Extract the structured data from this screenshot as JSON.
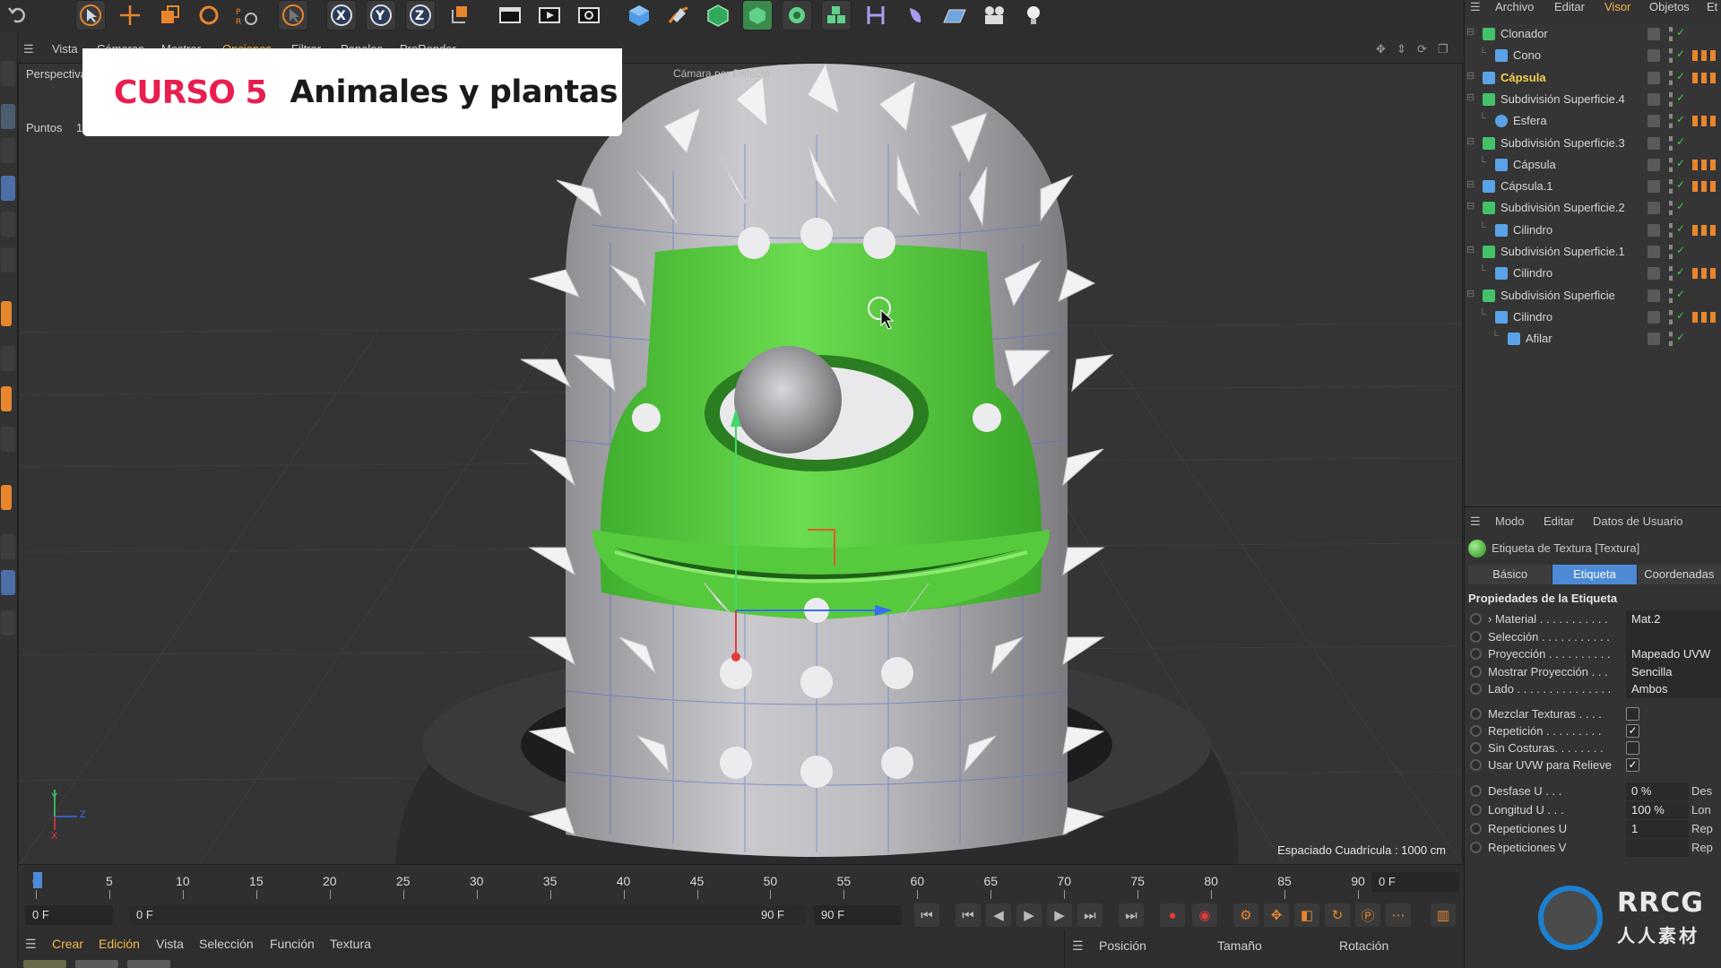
{
  "banner": {
    "tag": "CURSO 5",
    "title": "Animales y plantas"
  },
  "viewport": {
    "menu": [
      "Vista",
      "Cámaras",
      "Mostrar",
      "Opciones",
      "Filtrar",
      "Paneles",
      "ProRender"
    ],
    "active_menu": "Opciones",
    "camera_name": "Perspectiva",
    "camera_label": "Cámara por Defecto",
    "points_label": "Puntos",
    "points_value": "1",
    "grid_spacing": "Espaciado Cuadrícula : 1000 cm",
    "axis_y": "Y",
    "axis_z": "Z",
    "axis_x": "X"
  },
  "timeline": {
    "ticks": [
      "0",
      "5",
      "10",
      "15",
      "20",
      "25",
      "30",
      "35",
      "40",
      "45",
      "50",
      "55",
      "60",
      "65",
      "70",
      "75",
      "80",
      "85",
      "90"
    ],
    "current_frame": "0 F"
  },
  "transport": {
    "start": "0 F",
    "range_start": "0 F",
    "range_end": "90 F",
    "end": "90 F"
  },
  "bottom_bar": {
    "items": [
      "Crear",
      "Edición",
      "Vista",
      "Selección",
      "Función",
      "Textura"
    ],
    "coords": [
      "Posición",
      "Tamaño",
      "Rotación"
    ]
  },
  "object_manager": {
    "menu": [
      "Archivo",
      "Editar",
      "Visor",
      "Objetos",
      "Et"
    ],
    "active_menu": "Visor",
    "items": [
      {
        "label": "Clonador",
        "icon": "cloner-icon",
        "depth": 0,
        "color": "#44c26a"
      },
      {
        "label": "Cono",
        "icon": "cone-icon",
        "depth": 1,
        "color": "#5aa3e8"
      },
      {
        "label": "Cápsula",
        "icon": "capsule-icon",
        "depth": 0,
        "color": "#5aa3e8",
        "selected": true
      },
      {
        "label": "Subdivisión Superficie.4",
        "icon": "subdivision-icon",
        "depth": 0,
        "color": "#44c26a"
      },
      {
        "label": "Esfera",
        "icon": "sphere-icon",
        "depth": 1,
        "color": "#5aa3e8"
      },
      {
        "label": "Subdivisión Superficie.3",
        "icon": "subdivision-icon",
        "depth": 0,
        "color": "#44c26a"
      },
      {
        "label": "Cápsula",
        "icon": "capsule-icon",
        "depth": 1,
        "color": "#5aa3e8"
      },
      {
        "label": "Cápsula.1",
        "icon": "capsule-icon",
        "depth": 0,
        "color": "#5aa3e8"
      },
      {
        "label": "Subdivisión Superficie.2",
        "icon": "subdivision-icon",
        "depth": 0,
        "color": "#44c26a"
      },
      {
        "label": "Cilindro",
        "icon": "cylinder-icon",
        "depth": 1,
        "color": "#5aa3e8"
      },
      {
        "label": "Subdivisión Superficie.1",
        "icon": "subdivision-icon",
        "depth": 0,
        "color": "#44c26a"
      },
      {
        "label": "Cilindro",
        "icon": "cylinder-icon",
        "depth": 1,
        "color": "#5aa3e8"
      },
      {
        "label": "Subdivisión Superficie",
        "icon": "subdivision-icon",
        "depth": 0,
        "color": "#44c26a"
      },
      {
        "label": "Cilindro",
        "icon": "cylinder-icon",
        "depth": 1,
        "color": "#5aa3e8"
      },
      {
        "label": "Afilar",
        "icon": "taper-icon",
        "depth": 2,
        "color": "#5aa3e8"
      }
    ]
  },
  "attributes": {
    "menu": [
      "Modo",
      "Editar",
      "Datos de Usuario"
    ],
    "tag_title": "Etiqueta de Textura [Textura]",
    "tabs": [
      "Básico",
      "Etiqueta",
      "Coordenadas"
    ],
    "active_tab": "Etiqueta",
    "section": "Propiedades de la Etiqueta",
    "props": [
      {
        "label": "› Material . . . . . . . . . . .",
        "value": "Mat.2"
      },
      {
        "label": "Selección . . . . . . . . . . .",
        "value": ""
      },
      {
        "label": "Proyección . . . . . . . . . .",
        "value": "Mapeado UVW"
      },
      {
        "label": "Mostrar Proyección . . .",
        "value": "Sencilla"
      },
      {
        "label": "Lado . . . . . . . . . . . . . . .",
        "value": "Ambos"
      }
    ],
    "checks": [
      {
        "label": "Mezclar Texturas . . . .",
        "checked": false
      },
      {
        "label": "Repetición . . . . . . . . .",
        "checked": true
      },
      {
        "label": "Sin Costuras. . . . . . . .",
        "checked": false
      },
      {
        "label": "Usar UVW para Relieve",
        "checked": true
      }
    ],
    "numeric": [
      {
        "label": "Desfase U . . .",
        "value": "0 %",
        "extra": "Des"
      },
      {
        "label": "Longitud U . . .",
        "value": "100 %",
        "extra": "Lon"
      },
      {
        "label": "Repeticiones U",
        "value": "1",
        "extra": "Rep"
      },
      {
        "label": "Repeticiones V",
        "value": "",
        "extra": "Rep"
      }
    ]
  },
  "watermark": {
    "text": "RRCG",
    "sub": "人人素材"
  },
  "colors": {
    "accent": "#4d8ad6",
    "banner_red": "#e81e4f",
    "mesh_green": "#5fd14a",
    "selected_text": "#f2d04e"
  }
}
